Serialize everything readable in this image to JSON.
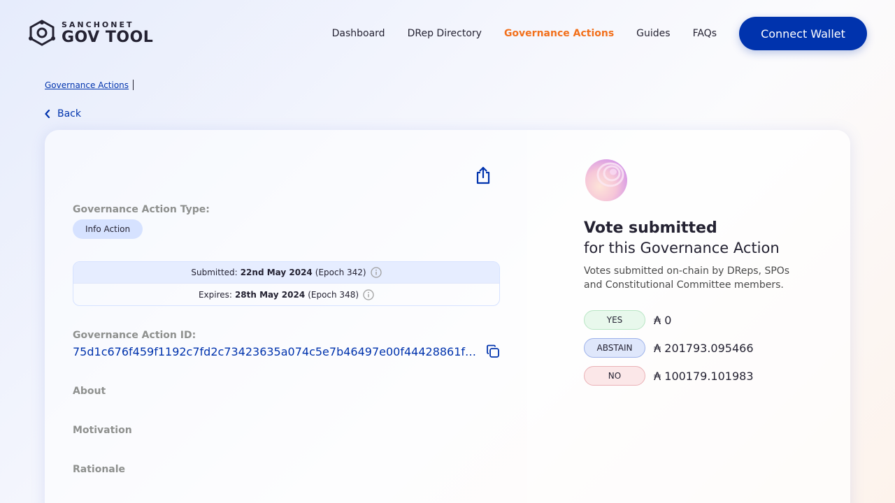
{
  "brand": {
    "small": "SANCHONET",
    "big": "GOV TOOL"
  },
  "nav": {
    "items": [
      {
        "label": "Dashboard"
      },
      {
        "label": "DRep Directory"
      },
      {
        "label": "Governance Actions"
      },
      {
        "label": "Guides"
      },
      {
        "label": "FAQs"
      }
    ],
    "connect_label": "Connect Wallet"
  },
  "breadcrumb": {
    "link": "Governance Actions"
  },
  "back_label": "Back",
  "action": {
    "type_label": "Governance Action Type:",
    "type_value": "Info Action",
    "submitted_prefix": "Submitted:",
    "submitted_date": "22nd May 2024",
    "submitted_epoch": "(Epoch 342)",
    "expires_prefix": "Expires:",
    "expires_date": "28th May 2024",
    "expires_epoch": "(Epoch 348)",
    "id_label": "Governance Action ID:",
    "id_value": "75d1c676f459f1192c7fd2c73423635a074c5e7b46497e00f44428861f460...",
    "about_label": "About",
    "motivation_label": "Motivation",
    "rationale_label": "Rationale"
  },
  "vote": {
    "title": "Vote submitted",
    "subtitle": "for this Governance Action",
    "description": "Votes submitted on-chain by DReps, SPOs and Constitutional Committee members.",
    "yes_label": "YES",
    "yes_value": "₳ 0",
    "abstain_label": "ABSTAIN",
    "abstain_value": "₳ 201793.095466",
    "no_label": "NO",
    "no_value": "₳ 100179.101983"
  },
  "colors": {
    "primary": "#0033ad",
    "accent": "#f2701c"
  }
}
